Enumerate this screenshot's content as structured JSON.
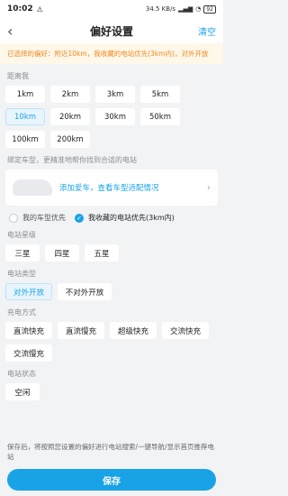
{
  "status": {
    "time": "10:02",
    "net": "34.5 KB/s",
    "battery": "92"
  },
  "nav": {
    "title": "偏好设置",
    "clear": "清空"
  },
  "notice": "已选择的偏好：附近10km，我收藏的电站优先(3km内)，对外开放",
  "distance": {
    "title": "距离我",
    "options": [
      "1km",
      "2km",
      "3km",
      "5km",
      "10km",
      "20km",
      "30km",
      "50km",
      "100km",
      "200km"
    ],
    "selected": "10km"
  },
  "car": {
    "title": "绑定车型，更精准地帮你找到合适的电站",
    "card_text": "添加爱车，查看车型适配情况",
    "opt_my_car": "我的车型优先",
    "opt_fav": "我收藏的电站优先(3km内)"
  },
  "star": {
    "title": "电站星级",
    "options": [
      "三星",
      "四星",
      "五星"
    ]
  },
  "type": {
    "title": "电站类型",
    "options": [
      "对外开放",
      "不对外开放"
    ],
    "selected": "对外开放"
  },
  "charge": {
    "title": "充电方式",
    "options": [
      "直流快充",
      "直流慢充",
      "超级快充",
      "交流快充",
      "交流慢充"
    ]
  },
  "station_status": {
    "title": "电站状态",
    "options": [
      "空闲"
    ]
  },
  "footer": {
    "hint": "保存后，将按照您设置的偏好进行电站搜索/一键导航/显示首页推荐电站",
    "save": "保存"
  }
}
